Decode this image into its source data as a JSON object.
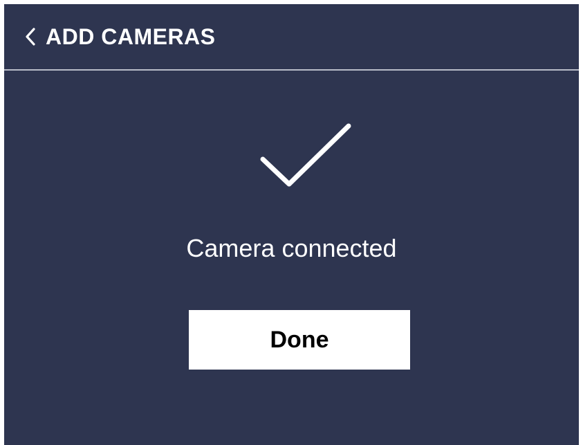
{
  "header": {
    "title": "ADD CAMERAS",
    "back_icon": "chevron-left-icon"
  },
  "main": {
    "status_icon": "checkmark-icon",
    "status_text": "Camera connected",
    "done_label": "Done"
  },
  "colors": {
    "background": "#2e3550",
    "header_divider": "#b9bcc8",
    "text": "#ffffff",
    "button_background": "#ffffff",
    "button_text": "#000000"
  }
}
